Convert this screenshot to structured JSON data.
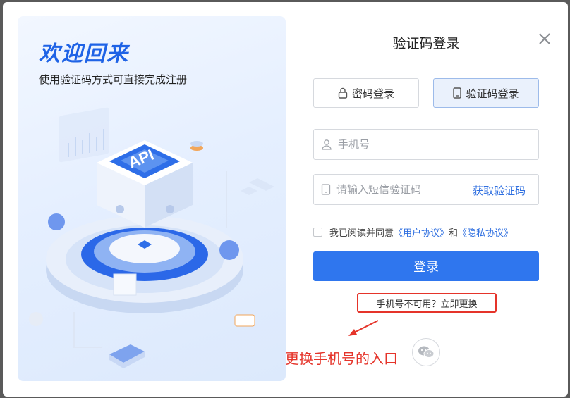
{
  "hero": {
    "title": "欢迎回来",
    "subtitle": "使用验证码方式可直接完成注册",
    "badge": "API"
  },
  "form": {
    "title": "验证码登录",
    "tabs": [
      {
        "label": "密码登录",
        "icon": "lock-icon",
        "active": false
      },
      {
        "label": "验证码登录",
        "icon": "phone-icon",
        "active": true
      }
    ],
    "phone_placeholder": "手机号",
    "code_placeholder": "请输入短信验证码",
    "get_code_label": "获取验证码",
    "agree_prefix": "我已阅读并同意",
    "user_agreement": "《用户协议》",
    "agree_and": "和",
    "privacy_policy": "《隐私协议》",
    "login_label": "登录",
    "change_phone_label": "手机号不可用？立即更换"
  },
  "annotation": {
    "text": "更换手机号的入口",
    "color": "#e5342a"
  },
  "colors": {
    "accent": "#2f76ee",
    "link": "#2f6fe0",
    "hero_title": "#1f63e6"
  }
}
